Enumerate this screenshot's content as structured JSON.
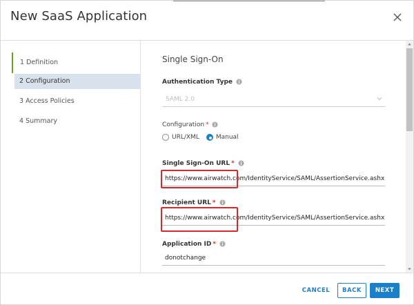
{
  "dialog": {
    "title": "New SaaS Application"
  },
  "nav": {
    "items": [
      {
        "label": "1 Definition"
      },
      {
        "label": "2 Configuration"
      },
      {
        "label": "3 Access Policies"
      },
      {
        "label": "4 Summary"
      }
    ]
  },
  "form": {
    "section_title": "Single Sign-On",
    "auth_type": {
      "label": "Authentication Type",
      "value": "SAML 2.0"
    },
    "configuration": {
      "label": "Configuration",
      "required_mark": "*",
      "options": [
        {
          "label": "URL/XML",
          "checked": false
        },
        {
          "label": "Manual",
          "checked": true
        }
      ]
    },
    "sso_url": {
      "label": "Single Sign-On URL",
      "required_mark": "*",
      "value": "https://www.airwatch.com/IdentityService/SAML/AssertionService.ashx?bindir"
    },
    "recipient_url": {
      "label": "Recipient URL",
      "required_mark": "*",
      "value": "https://www.airwatch.com/IdentityService/SAML/AssertionService.ashx?bindir"
    },
    "application_id": {
      "label": "Application ID",
      "required_mark": "*",
      "value": "donotchange"
    }
  },
  "footer": {
    "cancel_label": "CANCEL",
    "back_label": "BACK",
    "next_label": "NEXT"
  },
  "colors": {
    "accent": "#1a7fc7",
    "step_done": "#62a420",
    "active_step_bg": "#d7e2ec",
    "highlight": "#d9262b"
  },
  "icons": {
    "close": "close-icon",
    "info": "info-icon",
    "dropdown": "chevron-down-icon"
  }
}
